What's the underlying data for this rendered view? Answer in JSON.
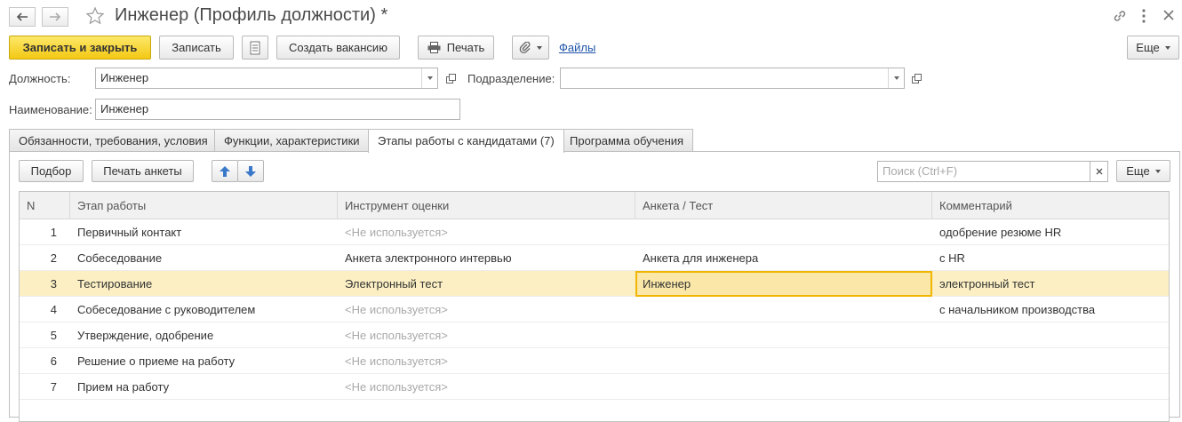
{
  "window": {
    "title": "Инженер (Профиль должности) *"
  },
  "toolbar": {
    "save_close_label": "Записать и закрыть",
    "save_label": "Записать",
    "create_vacancy_label": "Создать вакансию",
    "print_label": "Печать",
    "files_label": "Файлы",
    "more_label": "Еще"
  },
  "form": {
    "position_label": "Должность:",
    "position_value": "Инженер",
    "department_label": "Подразделение:",
    "department_value": "",
    "name_label": "Наименование:",
    "name_value": "Инженер"
  },
  "tabs": [
    {
      "label": "Обязанности, требования, условия",
      "active": false
    },
    {
      "label": "Функции, характеристики",
      "active": false
    },
    {
      "label": "Этапы работы с кандидатами (7)",
      "active": true
    },
    {
      "label": "Программа обучения",
      "active": false
    }
  ],
  "table_toolbar": {
    "select_label": "Подбор",
    "print_form_label": "Печать анкеты",
    "search_placeholder": "Поиск (Ctrl+F)",
    "more_label": "Еще"
  },
  "table": {
    "columns": [
      "N",
      "Этап работы",
      "Инструмент оценки",
      "Анкета / Тест",
      "Комментарий"
    ],
    "rows": [
      {
        "n": "1",
        "stage": "Первичный контакт",
        "tool": "<Не используется>",
        "test": "",
        "comment": "одобрение резюме HR"
      },
      {
        "n": "2",
        "stage": "Собеседование",
        "tool": "Анкета электронного интервью",
        "test": "Анкета для инженера",
        "comment": "с HR"
      },
      {
        "n": "3",
        "stage": "Тестирование",
        "tool": "Электронный тест",
        "test": "Инженер",
        "comment": "электронный тест"
      },
      {
        "n": "4",
        "stage": "Собеседование с руководителем",
        "tool": "<Не используется>",
        "test": "",
        "comment": "с начальником производства"
      },
      {
        "n": "5",
        "stage": "Утверждение, одобрение",
        "tool": "<Не используется>",
        "test": "",
        "comment": ""
      },
      {
        "n": "6",
        "stage": "Решение о приеме на работу",
        "tool": "<Не используется>",
        "test": "",
        "comment": ""
      },
      {
        "n": "7",
        "stage": "Прием на работу",
        "tool": "<Не используется>",
        "test": "",
        "comment": ""
      }
    ],
    "selected_row": 2
  },
  "colors": {
    "primary_button": "#f3c914",
    "selected_row": "#fbefc3",
    "link": "#1f54a8",
    "muted_text": "#a9a9a9"
  },
  "icons": [
    "back-arrow-icon",
    "forward-arrow-icon",
    "star-icon",
    "link-icon",
    "kebab-menu-icon",
    "close-icon",
    "document-list-icon",
    "printer-icon",
    "paperclip-icon",
    "move-up-icon",
    "move-down-icon",
    "open-form-icon",
    "clear-icon"
  ]
}
